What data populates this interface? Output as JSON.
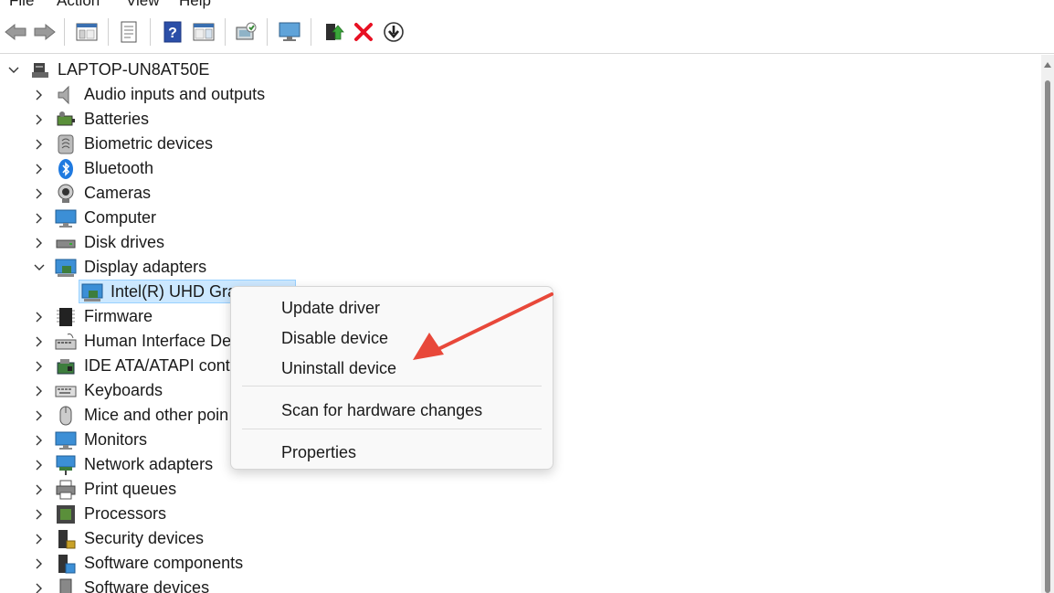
{
  "menu": {
    "file": "File",
    "action": "Action",
    "view": "View",
    "help": "Help"
  },
  "toolbar": {
    "buttons": [
      "back-arrow-icon",
      "forward-arrow-icon",
      "show-hide-console-tree-icon",
      "properties-sheet-icon",
      "help-icon",
      "action-pane-icon",
      "scan-hardware-icon",
      "display-monitor-icon",
      "update-driver-icon",
      "uninstall-x-icon",
      "rollback-download-icon"
    ]
  },
  "tree": {
    "root": "LAPTOP-UN8AT50E",
    "categories": [
      {
        "label": "Audio inputs and outputs",
        "icon": "speaker-icon"
      },
      {
        "label": "Batteries",
        "icon": "battery-icon"
      },
      {
        "label": "Biometric devices",
        "icon": "fingerprint-icon"
      },
      {
        "label": "Bluetooth",
        "icon": "bluetooth-icon"
      },
      {
        "label": "Cameras",
        "icon": "camera-icon"
      },
      {
        "label": "Computer",
        "icon": "computer-icon"
      },
      {
        "label": "Disk drives",
        "icon": "disk-drive-icon"
      },
      {
        "label": "Display adapters",
        "icon": "display-adapter-icon"
      },
      {
        "label": "Firmware",
        "icon": "firmware-chip-icon"
      },
      {
        "label": "Human Interface Dev",
        "icon": "hid-keyboard-icon"
      },
      {
        "label": "IDE ATA/ATAPI contro",
        "icon": "ide-controller-icon"
      },
      {
        "label": "Keyboards",
        "icon": "keyboard-icon"
      },
      {
        "label": "Mice and other poin",
        "icon": "mouse-icon"
      },
      {
        "label": "Monitors",
        "icon": "monitor-icon"
      },
      {
        "label": "Network adapters",
        "icon": "network-adapter-icon"
      },
      {
        "label": "Print queues",
        "icon": "printer-icon"
      },
      {
        "label": "Processors",
        "icon": "processor-icon"
      },
      {
        "label": "Security devices",
        "icon": "security-device-icon"
      },
      {
        "label": "Software components",
        "icon": "software-component-icon"
      },
      {
        "label": "Software devices",
        "icon": "software-device-icon"
      }
    ],
    "selected_device": "Intel(R) UHD Grap"
  },
  "context_menu": {
    "items": [
      "Update driver",
      "Disable device",
      "Uninstall device",
      "Scan for hardware changes",
      "Properties"
    ]
  },
  "colors": {
    "selection_bg": "#cce8ff",
    "selection_border": "#99d1ff",
    "arrow_annotation": "#e8483a",
    "uninstall_x": "#e81123"
  }
}
